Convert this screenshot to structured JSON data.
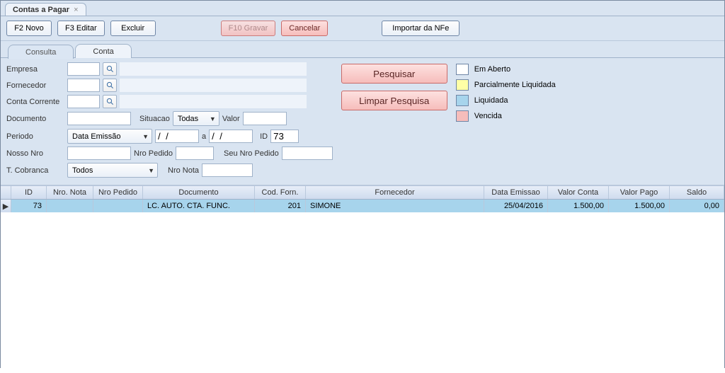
{
  "window": {
    "title": "Contas a Pagar"
  },
  "toolbar": {
    "novo": "F2 Novo",
    "editar": "F3 Editar",
    "excluir": "Excluir",
    "gravar": "F10 Gravar",
    "cancelar": "Cancelar",
    "importar": "Importar da NFe"
  },
  "tabs": {
    "consulta": "Consulta",
    "conta": "Conta"
  },
  "labels": {
    "empresa": "Empresa",
    "fornecedor": "Fornecedor",
    "contaCorrente": "Conta Corrente",
    "documento": "Documento",
    "situacao": "Situacao",
    "valor": "Valor",
    "periodo": "Periodo",
    "a": "a",
    "id": "ID",
    "nossoNro": "Nosso Nro",
    "nroPedido": "Nro Pedido",
    "seuNroPedido": "Seu Nro Pedido",
    "tCobranca": "T. Cobranca",
    "nroNota": "Nro Nota"
  },
  "combos": {
    "situacao": "Todas",
    "periodo": "Data Emissão",
    "tCobranca": "Todos"
  },
  "fields": {
    "periodoDe": "/  /",
    "periodoAte": "/  /",
    "idValue": "73"
  },
  "buttons": {
    "pesquisar": "Pesquisar",
    "limpar": "Limpar Pesquisa"
  },
  "legend": {
    "aberto": {
      "label": "Em Aberto",
      "color": "#ffffff"
    },
    "parcial": {
      "label": "Parcialmente Liquidada",
      "color": "#ffffa6"
    },
    "liquidada": {
      "label": "Liquidada",
      "color": "#a7d4ec"
    },
    "vencida": {
      "label": "Vencida",
      "color": "#f6bdbb"
    }
  },
  "grid": {
    "headers": {
      "id": "ID",
      "nroNota": "Nro. Nota",
      "nroPedido": "Nro Pedido",
      "documento": "Documento",
      "codForn": "Cod. Forn.",
      "fornecedor": "Fornecedor",
      "dataEmissao": "Data Emissao",
      "valorConta": "Valor Conta",
      "valorPago": "Valor Pago",
      "saldo": "Saldo"
    },
    "rows": [
      {
        "id": "73",
        "nroNota": "",
        "nroPedido": "",
        "documento": "LC. AUTO. CTA. FUNC.",
        "codForn": "201",
        "fornecedor": "SIMONE",
        "dataEmissao": "25/04/2016",
        "valorConta": "1.500,00",
        "valorPago": "1.500,00",
        "saldo": "0,00",
        "statusColor": "#a7d4ec"
      }
    ]
  }
}
